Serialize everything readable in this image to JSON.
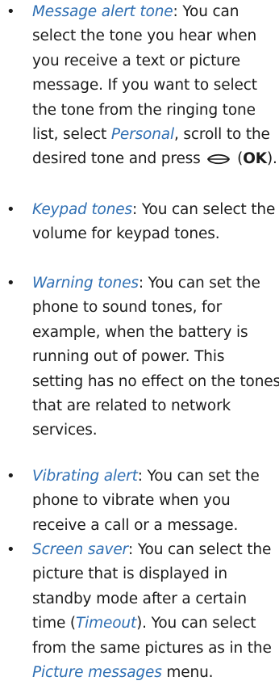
{
  "colors": {
    "text": "#1c1c1c",
    "term": "#2f6fb3"
  },
  "bullet_glyph": "•",
  "items": [
    {
      "lines": [
        [
          {
            "t": "Message alert tone",
            "c": "term"
          },
          {
            "t": ": You can"
          }
        ],
        [
          {
            "t": "select the tone you hear when"
          }
        ],
        [
          {
            "t": "you receive a text or picture"
          }
        ],
        [
          {
            "t": "message. If you want to select"
          }
        ],
        [
          {
            "t": "the tone from the ringing tone"
          }
        ],
        [
          {
            "t": "list, select "
          },
          {
            "t": "Personal",
            "c": "term"
          },
          {
            "t": ", scroll to the"
          }
        ],
        [
          {
            "t": "desired tone and press "
          },
          {
            "icon": "selection-key-icon"
          },
          {
            "t": " ("
          },
          {
            "t": "OK",
            "c": "kbd"
          },
          {
            "t": ")."
          }
        ]
      ]
    },
    {
      "lines": [
        [
          {
            "t": "Keypad tones",
            "c": "term"
          },
          {
            "t": ": You can select the"
          }
        ],
        [
          {
            "t": "volume for keypad tones."
          }
        ]
      ]
    },
    {
      "lines": [
        [
          {
            "t": "Warning tones",
            "c": "term"
          },
          {
            "t": ": You can set the"
          }
        ],
        [
          {
            "t": "phone to sound tones, for"
          }
        ],
        [
          {
            "t": "example, when the battery is"
          }
        ],
        [
          {
            "t": "running out of power. This"
          }
        ],
        [
          {
            "t": "setting has no effect on the tones"
          }
        ],
        [
          {
            "t": "that are related to network"
          }
        ],
        [
          {
            "t": "services."
          }
        ]
      ]
    },
    {
      "lines": [
        [
          {
            "t": "Vibrating alert",
            "c": "term"
          },
          {
            "t": ": You can set the"
          }
        ],
        [
          {
            "t": "phone to vibrate when you"
          }
        ],
        [
          {
            "t": "receive a call or a message."
          }
        ]
      ]
    },
    {
      "lines": [
        [
          {
            "t": "Screen saver",
            "c": "term"
          },
          {
            "t": ": You can select the"
          }
        ],
        [
          {
            "t": "picture that is displayed in"
          }
        ],
        [
          {
            "t": "standby mode after a certain"
          }
        ],
        [
          {
            "t": "time ("
          },
          {
            "t": "Timeout",
            "c": "term"
          },
          {
            "t": "). You can select"
          }
        ],
        [
          {
            "t": "from the same pictures as in the"
          }
        ],
        [
          {
            "t": "Picture messages",
            "c": "term"
          },
          {
            "t": " menu."
          }
        ]
      ]
    }
  ]
}
